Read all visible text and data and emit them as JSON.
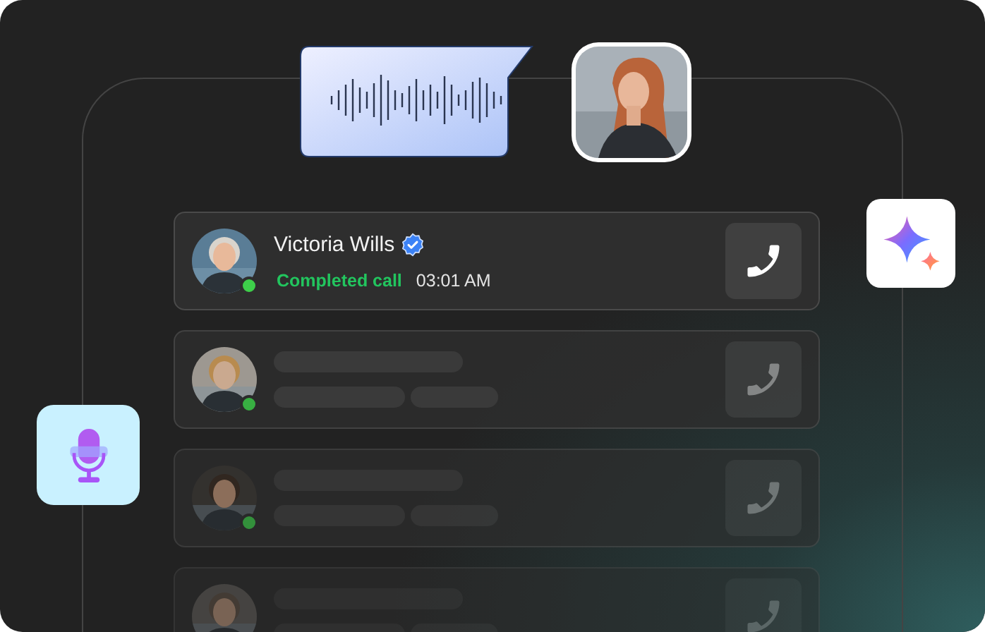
{
  "contacts": [
    {
      "kind": "detail",
      "name": "Victoria Wills",
      "verified": true,
      "online": true,
      "status": "Completed call",
      "time": "03:01 AM"
    },
    {
      "kind": "placeholder",
      "online": true
    },
    {
      "kind": "placeholder",
      "online": true
    },
    {
      "kind": "placeholder"
    }
  ]
}
